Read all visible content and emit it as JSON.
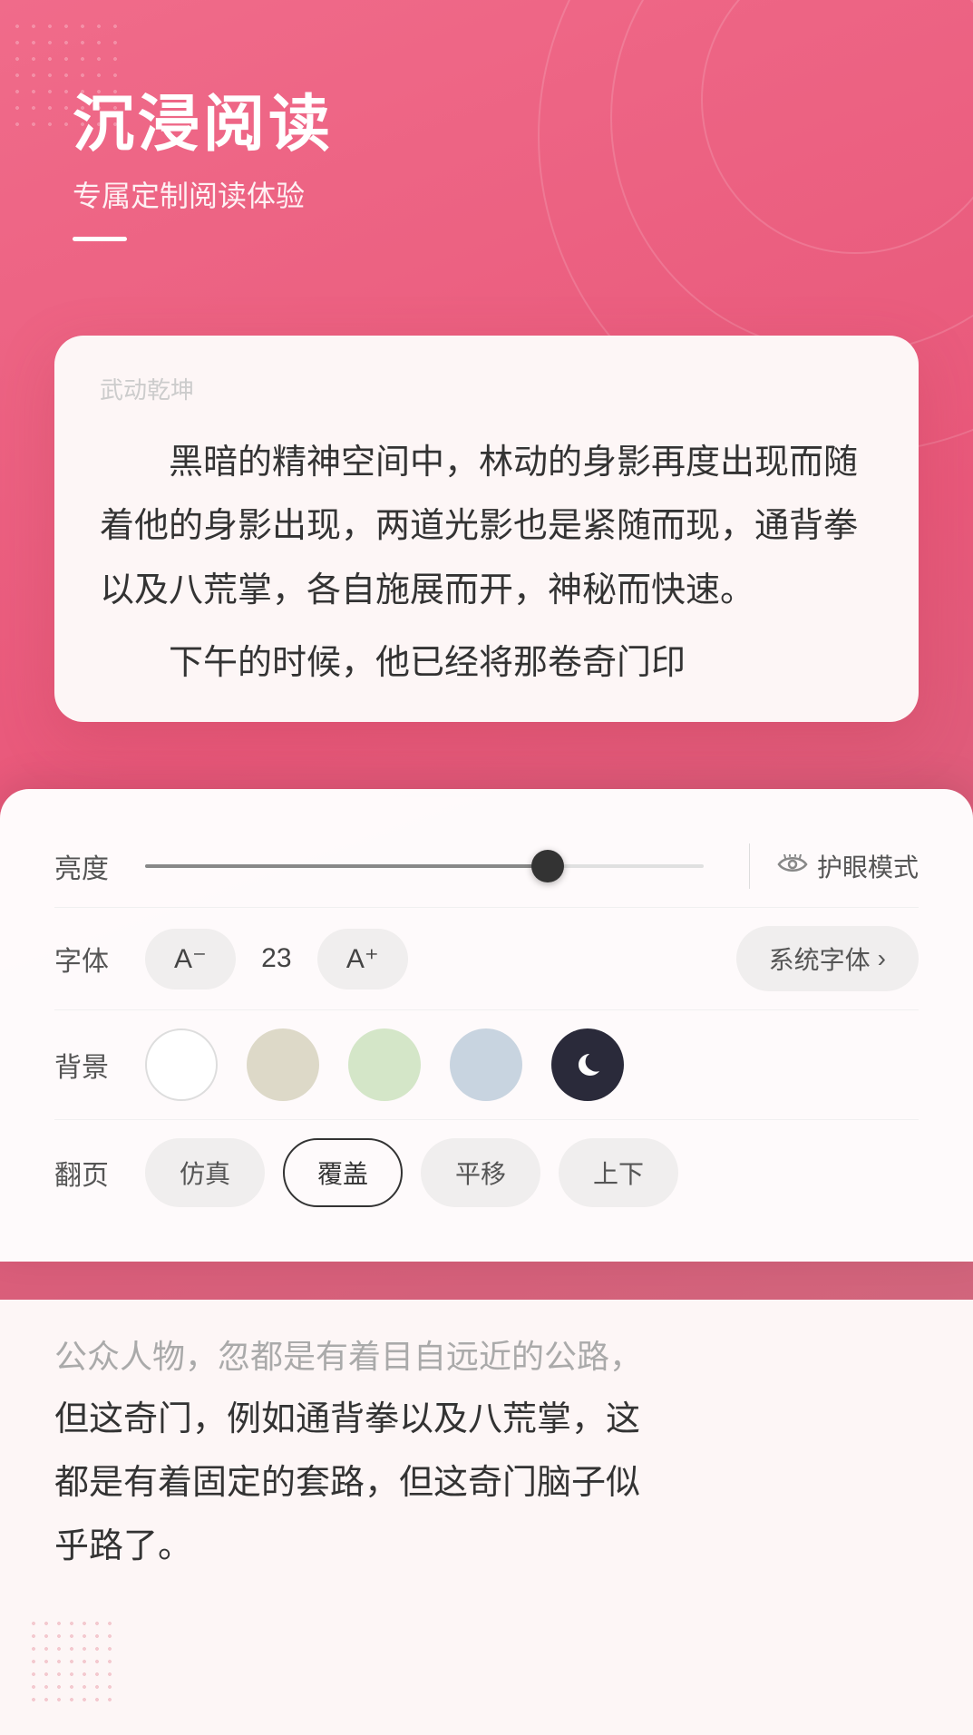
{
  "header": {
    "title": "沉浸阅读",
    "subtitle": "专属定制阅读体验"
  },
  "reader": {
    "book_title": "武动乾坤",
    "paragraph1": "黑暗的精神空间中，林动的身影再度出现而随着他的身影出现，两道光影也是紧随而现，通背拳以及八荒掌，各自施展而开，神秘而快速。",
    "paragraph2": "下午的时候，他已经将那卷奇门印"
  },
  "settings": {
    "brightness_label": "亮度",
    "brightness_value": 72,
    "eye_mode_label": "护眼模式",
    "font_label": "字体",
    "font_decrease": "A⁻",
    "font_size": "23",
    "font_increase": "A⁺",
    "font_family": "系统字体",
    "font_family_arrow": "›",
    "background_label": "背景",
    "page_turn_label": "翻页",
    "page_turn_options": [
      {
        "id": "simulated",
        "label": "仿真",
        "active": false
      },
      {
        "id": "cover",
        "label": "覆盖",
        "active": true
      },
      {
        "id": "slide",
        "label": "平移",
        "active": false
      },
      {
        "id": "vertical",
        "label": "上下",
        "active": false
      }
    ]
  },
  "bottom_content": {
    "partial": "公众人物，忽都是有着目自远近的公路，",
    "text1": "但这奇门，例如通背拳以及八荒掌，这",
    "text2": "都是有着固定的套路，但这奇门脑子似",
    "text3": "乎路了。"
  }
}
